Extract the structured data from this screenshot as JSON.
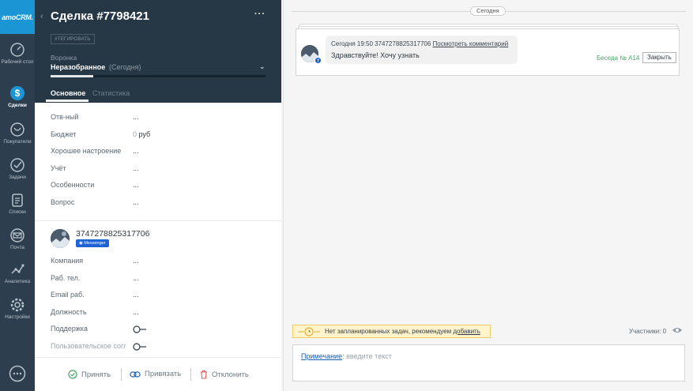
{
  "nav": {
    "logo": "amoCRM.",
    "items": [
      {
        "label": "Рабочий стол",
        "icon": "dashboard-icon"
      },
      {
        "label": "Сделки",
        "icon": "deals-dollar-icon"
      },
      {
        "label": "Покупатели",
        "icon": "customers-icon"
      },
      {
        "label": "Задачи",
        "icon": "tasks-check-icon"
      },
      {
        "label": "Списки",
        "icon": "lists-icon"
      },
      {
        "label": "Почта",
        "icon": "mail-icon"
      },
      {
        "label": "Аналитика",
        "icon": "analytics-icon"
      },
      {
        "label": "Настройки",
        "icon": "settings-gear-icon"
      }
    ],
    "bottom_icon": "chat-icon"
  },
  "lead": {
    "title": "Сделка #7798421",
    "tag": "#ТЕГИРОВАТЬ",
    "pipeline_label": "Воронка",
    "pipeline_value": "Неразобранное",
    "pipeline_date": "(Сегодня)",
    "pipeline_progress": 0.2,
    "tabs": {
      "main": "Основное",
      "stats": "Статистика"
    },
    "fields": [
      {
        "label": "Отв-ный",
        "value": "..."
      },
      {
        "label": "Бюджет",
        "zero": "0",
        "value": "руб"
      },
      {
        "label": "Хорошее настроение",
        "value": "..."
      },
      {
        "label": "Учёт",
        "value": "..."
      },
      {
        "label": "Особенности",
        "value": "..."
      },
      {
        "label": "Вопрос",
        "value": "..."
      }
    ]
  },
  "contact": {
    "name": "3747278825317706",
    "badge": "Messenger",
    "fields": [
      {
        "label": "Компания",
        "value": "..."
      },
      {
        "label": "Раб. тел.",
        "value": "..."
      },
      {
        "label": "Email раб.",
        "value": "..."
      },
      {
        "label": "Должность",
        "value": "..."
      }
    ],
    "toggles": [
      {
        "label": "Поддержка"
      },
      {
        "label": "Пользовательское согл"
      }
    ]
  },
  "footer": {
    "accept": "Принять",
    "link": "Привязать",
    "decline": "Отклонить"
  },
  "feed": {
    "day": "Сегодня",
    "message": {
      "meta": "Сегодня 19:50 3747278825317706",
      "view_link": "Посмотреть комментарий",
      "text": "Здравствуйте! Хочу узнать"
    },
    "conversation": "Беседа № А14",
    "close": "Закрыть",
    "task_text": "Нет запланированных задач, рекомендуем",
    "task_link": "добавить",
    "participants": "Участники: 0",
    "composer_type": "Примечание",
    "composer_placeholder": ": введите текст"
  },
  "colors": {
    "nav_bg": "#2d3e4e",
    "logo_bg": "#1b95d3",
    "header_bg": "#263746",
    "accent_green": "#4aa46a",
    "messenger_blue": "#1e63d6",
    "decline_red": "#e35b5b"
  }
}
